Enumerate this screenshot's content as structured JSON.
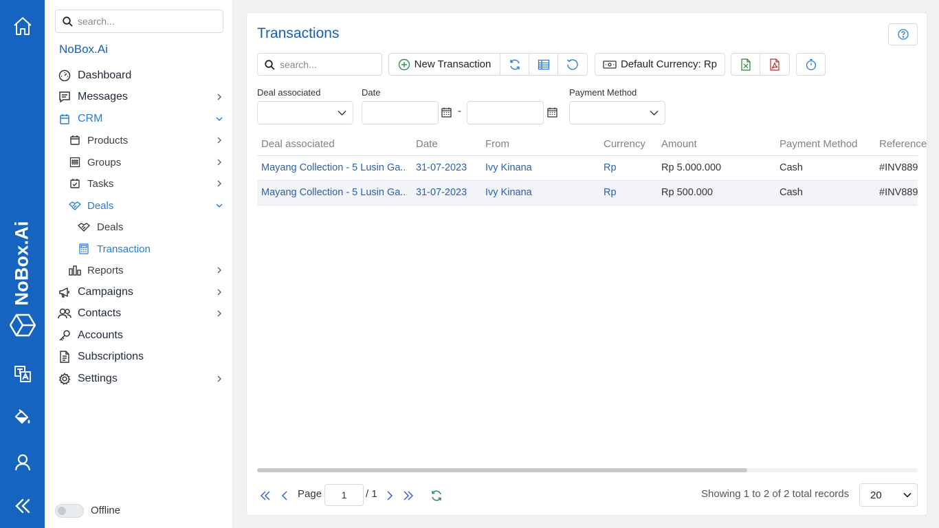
{
  "app": {
    "brand": "NoBox.Ai",
    "brand_vertical": "NoBox.Ai"
  },
  "sidebar": {
    "search_placeholder": "search...",
    "brand": "NoBox.Ai",
    "items": [
      {
        "label": "Dashboard",
        "icon": "dashboard-gauge-icon"
      },
      {
        "label": "Messages",
        "icon": "message-icon"
      },
      {
        "label": "CRM",
        "icon": "crm-icon"
      },
      {
        "label": "Products",
        "icon": "products-icon"
      },
      {
        "label": "Groups",
        "icon": "groups-icon"
      },
      {
        "label": "Tasks",
        "icon": "tasks-icon"
      },
      {
        "label": "Deals",
        "icon": "handshake-icon"
      },
      {
        "label": "Deals",
        "icon": "handshake-icon"
      },
      {
        "label": "Transaction",
        "icon": "calculator-icon"
      },
      {
        "label": "Reports",
        "icon": "reports-chart-icon"
      },
      {
        "label": "Campaigns",
        "icon": "megaphone-icon"
      },
      {
        "label": "Contacts",
        "icon": "contacts-icon"
      },
      {
        "label": "Accounts",
        "icon": "key-icon"
      },
      {
        "label": "Subscriptions",
        "icon": "document-icon"
      },
      {
        "label": "Settings",
        "icon": "gear-icon"
      }
    ],
    "offline_label": "Offline",
    "offline_enabled": false
  },
  "main": {
    "title": "Transactions",
    "search_placeholder": "search...",
    "new_transaction_label": "New Transaction",
    "default_currency_label": "Default Currency: Rp",
    "filters": {
      "deal_label": "Deal associated",
      "date_label": "Date",
      "date_separator": "-",
      "payment_label": "Payment Method"
    },
    "table": {
      "headers": [
        "Deal associated",
        "Date",
        "From",
        "Currency",
        "Amount",
        "Payment Method",
        "Reference"
      ],
      "rows": [
        [
          "Mayang Collection - 5 Lusin Ga...",
          "31-07-2023",
          "Ivy Kinana",
          "Rp",
          "Rp 5.000.000",
          "Cash",
          "#INV889"
        ],
        [
          "Mayang Collection - 5 Lusin Ga...",
          "31-07-2023",
          "Ivy Kinana",
          "Rp",
          "Rp 500.000",
          "Cash",
          "#INV889"
        ]
      ]
    },
    "pagination": {
      "page_label": "Page",
      "page_value": "1",
      "total_pages": "/ 1",
      "showing": "Showing 1 to 2 of 2 total records",
      "per_page": "20"
    }
  },
  "colors": {
    "rail": "#1565c0",
    "accent": "#1a5fb4",
    "link": "#2b5fb3"
  }
}
